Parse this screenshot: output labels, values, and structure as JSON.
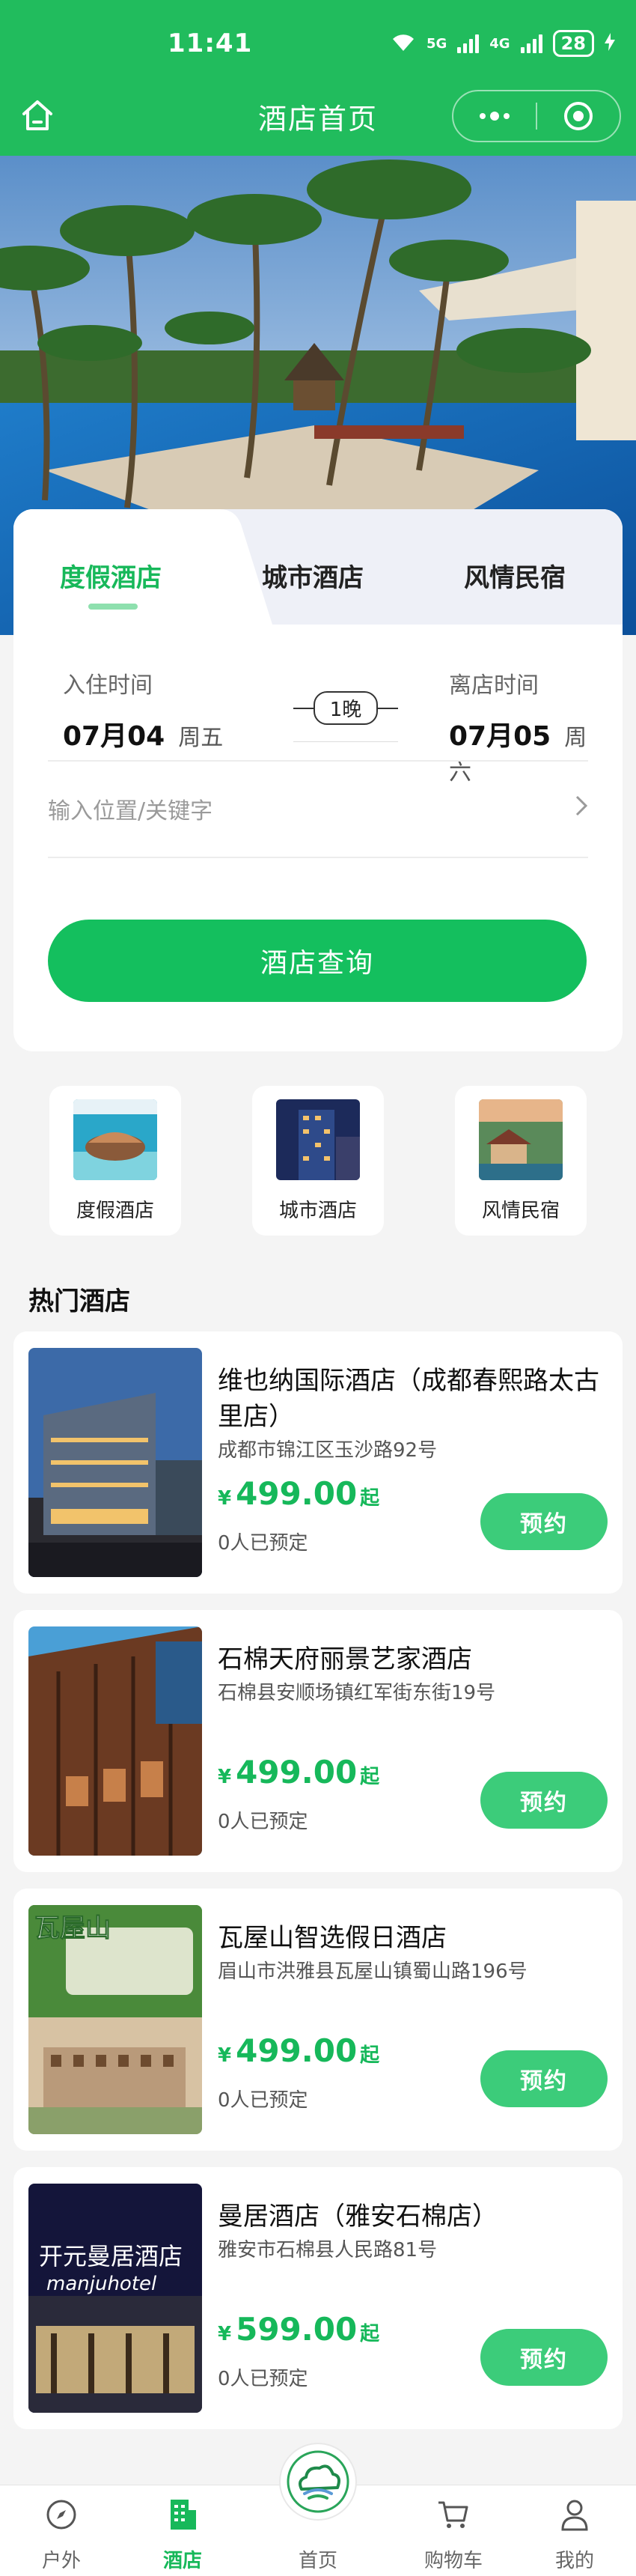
{
  "status_bar": {
    "time": "11:41",
    "network_1": "5G",
    "network_2": "4G",
    "battery": "28"
  },
  "nav": {
    "title": "酒店首页"
  },
  "tabs": [
    {
      "label": "度假酒店",
      "active": true
    },
    {
      "label": "城市酒店",
      "active": false
    },
    {
      "label": "风情民宿",
      "active": false
    }
  ],
  "dates": {
    "checkin_label": "入住时间",
    "checkin_date": "07月04",
    "checkin_week": "周五",
    "nights": "1晚",
    "checkout_label": "离店时间",
    "checkout_date": "07月05",
    "checkout_week": "周六"
  },
  "location": {
    "placeholder": "输入位置/关键字"
  },
  "search_button": "酒店查询",
  "categories": [
    {
      "label": "度假酒店"
    },
    {
      "label": "城市酒店"
    },
    {
      "label": "风情民宿"
    }
  ],
  "section_title": "热门酒店",
  "hotels": [
    {
      "name": "维也纳国际酒店（成都春熙路太古里店）",
      "address": "成都市锦江区玉沙路92号",
      "currency": "¥",
      "price": "499.00",
      "price_suffix": "起",
      "booked": "0人已预定",
      "book_label": "预约"
    },
    {
      "name": "石棉天府丽景艺家酒店",
      "address": "石棉县安顺场镇红军街东街19号",
      "currency": "¥",
      "price": "499.00",
      "price_suffix": "起",
      "booked": "0人已预定",
      "book_label": "预约"
    },
    {
      "name": "瓦屋山智选假日酒店",
      "address": "眉山市洪雅县瓦屋山镇蜀山路196号",
      "currency": "¥",
      "price": "499.00",
      "price_suffix": "起",
      "booked": "0人已预定",
      "book_label": "预约"
    },
    {
      "name": "曼居酒店（雅安石棉店）",
      "address": "雅安市石棉县人民路81号",
      "currency": "¥",
      "price": "599.00",
      "price_suffix": "起",
      "booked": "0人已预定",
      "book_label": "预约"
    }
  ],
  "image_text": {
    "hotel3_sign": "瓦屋山",
    "hotel4_sign_cn": "开元曼居酒店",
    "hotel4_sign_en": "manjuhotel"
  },
  "tabbar": [
    {
      "label": "户外",
      "icon": "compass-icon"
    },
    {
      "label": "酒店",
      "icon": "hotel-building-icon",
      "active": true
    },
    {
      "label": "首页",
      "icon": "cloud-logo-icon"
    },
    {
      "label": "购物车",
      "icon": "cart-icon"
    },
    {
      "label": "我的",
      "icon": "user-icon"
    }
  ],
  "colors": {
    "brand_green": "#21bc5d",
    "price_green": "#16b85a",
    "button_green": "#14bf5e"
  }
}
